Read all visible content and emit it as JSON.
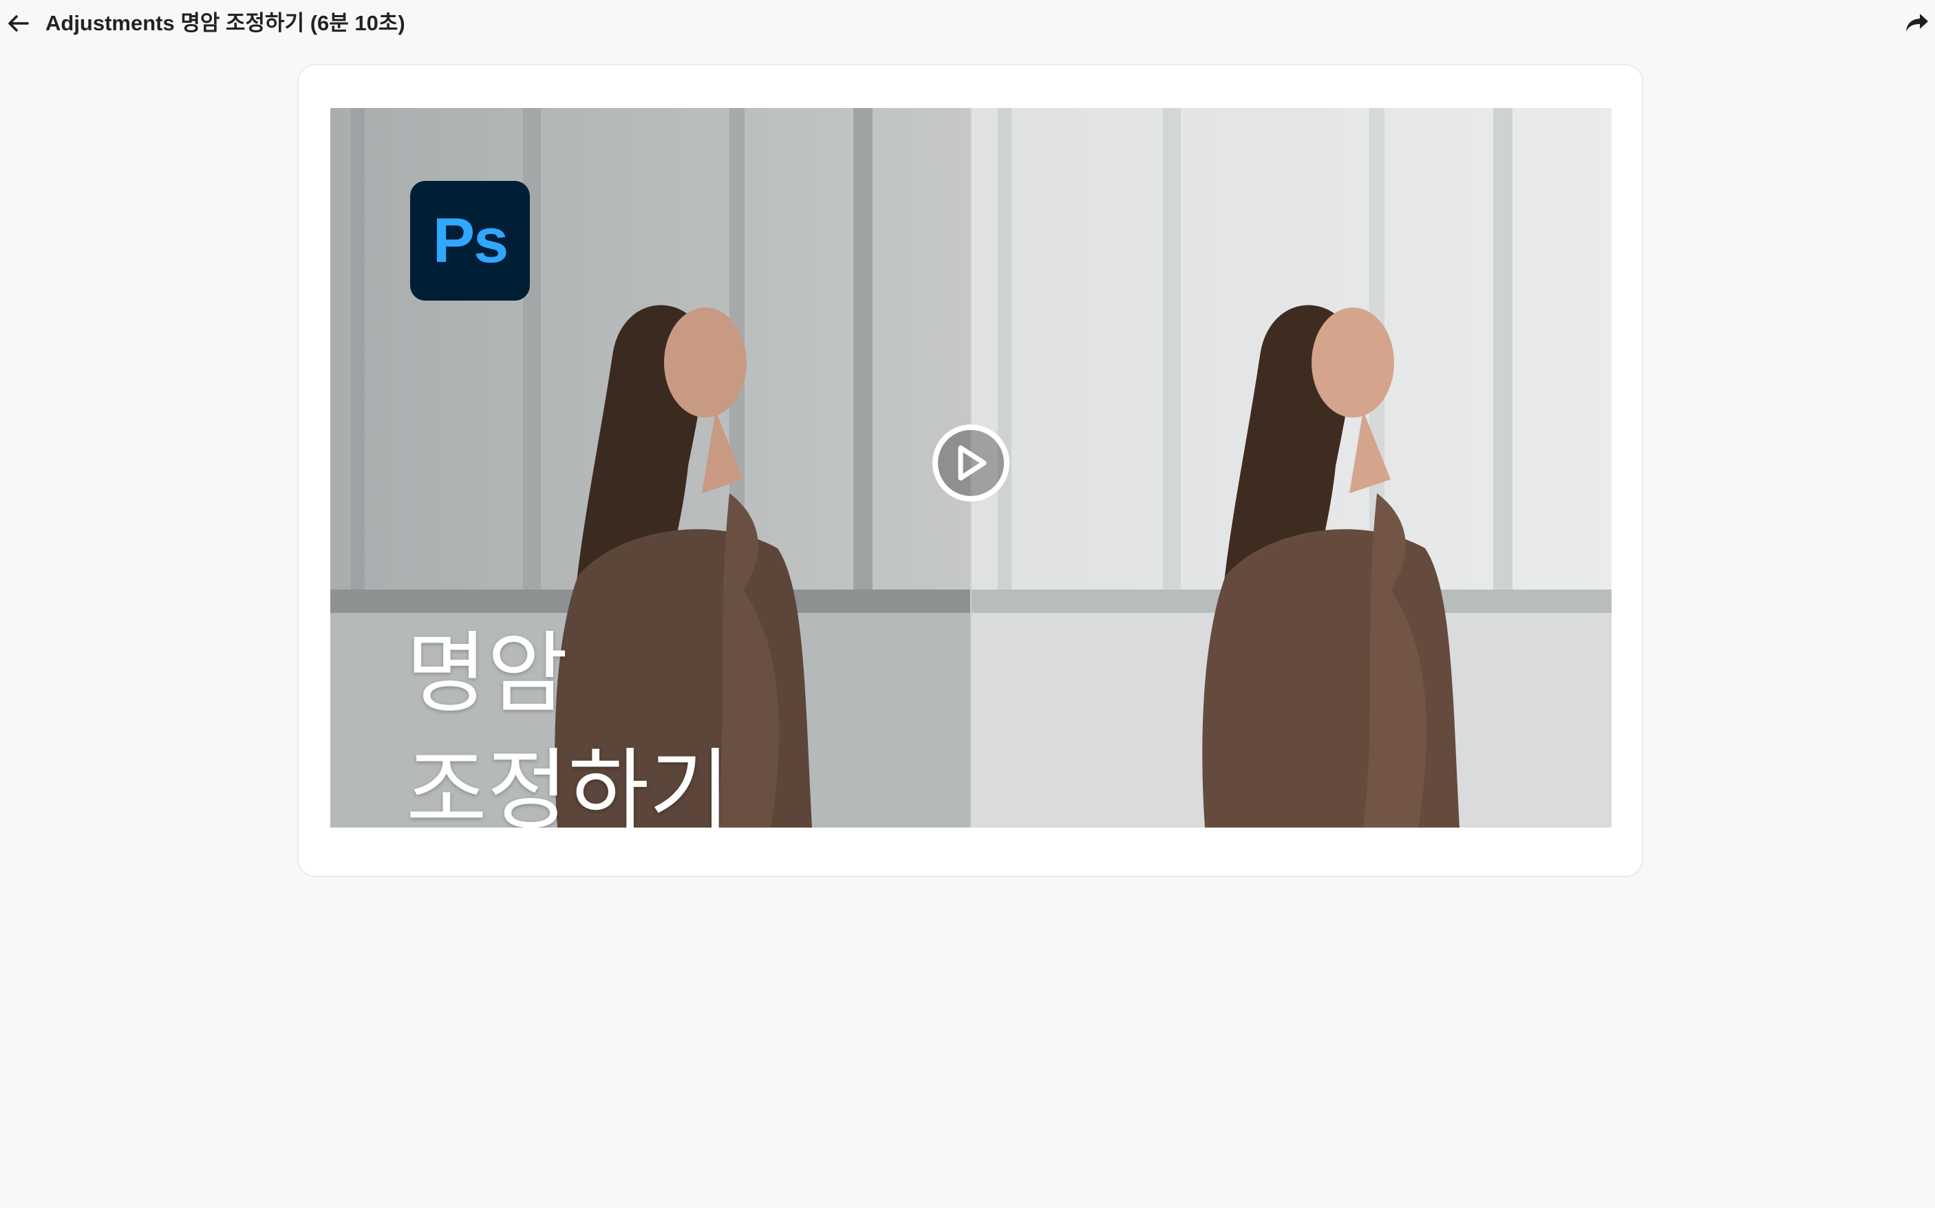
{
  "header": {
    "title": "Adjustments 명암 조정하기 (6분 10초)",
    "back_icon": "arrow-left-icon",
    "share_icon": "share-icon"
  },
  "video": {
    "thumbnail": {
      "logo_text": "Ps",
      "overlay_line1": "명암",
      "overlay_line2": "조정하기"
    },
    "play_icon": "play-circle-icon"
  },
  "colors": {
    "background": "#f7f8fa",
    "card": "#ffffff",
    "ps_logo_bg": "#001e36",
    "ps_logo_text": "#31a8ff"
  }
}
